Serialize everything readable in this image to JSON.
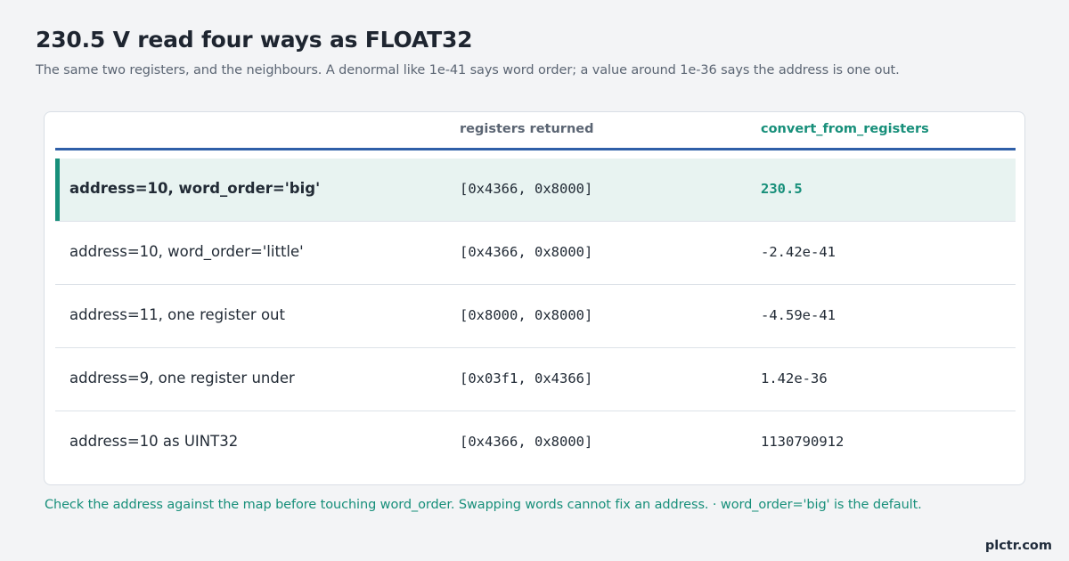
{
  "header": {
    "title": "230.5 V read four ways as FLOAT32",
    "subtitle": "The same two registers, and the neighbours. A denormal like 1e-41 says word order; a value around 1e-36 says the address is one out."
  },
  "table": {
    "columns": [
      "",
      "registers returned",
      "convert_from_registers"
    ],
    "rows": [
      {
        "label": "address=10, word_order='big'",
        "registers": "[0x4366, 0x8000]",
        "value": "230.5",
        "highlight": true
      },
      {
        "label": "address=10, word_order='little'",
        "registers": "[0x4366, 0x8000]",
        "value": "-2.42e-41",
        "highlight": false
      },
      {
        "label": "address=11, one register out",
        "registers": "[0x8000, 0x8000]",
        "value": "-4.59e-41",
        "highlight": false
      },
      {
        "label": "address=9, one register under",
        "registers": "[0x03f1, 0x4366]",
        "value": "1.42e-36",
        "highlight": false
      },
      {
        "label": "address=10 as UINT32",
        "registers": "[0x4366, 0x8000]",
        "value": "1130790912",
        "highlight": false
      }
    ]
  },
  "footnote": "Check the address against the map before touching word_order. Swapping words cannot fix an address. · word_order='big' is the default.",
  "brand": "plctr.com",
  "colors": {
    "accent": "#178f7a",
    "header_rule": "#2f5fa8",
    "highlight_bg": "#e8f3f1"
  }
}
